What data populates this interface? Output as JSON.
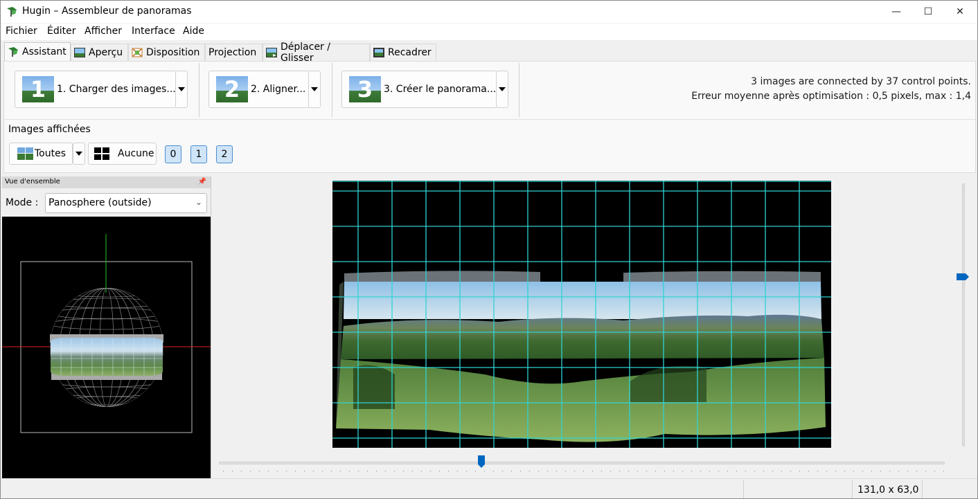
{
  "window": {
    "title": "Hugin – Assembleur de panoramas",
    "controls": {
      "minimize": "—",
      "maximize": "☐",
      "close": "✕"
    }
  },
  "menu": [
    "Fichier",
    "Éditer",
    "Afficher",
    "Interface",
    "Aide"
  ],
  "tabs": [
    {
      "label": "Assistant",
      "icon": "hugin-icon",
      "active": true
    },
    {
      "label": "Aperçu",
      "icon": "landscape-icon",
      "active": false
    },
    {
      "label": "Disposition",
      "icon": "layout-icon",
      "active": false
    },
    {
      "label": "Projection",
      "icon": "",
      "active": false
    },
    {
      "label": "Déplacer / Glisser",
      "icon": "move-icon",
      "active": false
    },
    {
      "label": "Recadrer",
      "icon": "crop-icon",
      "active": false
    }
  ],
  "steps": [
    {
      "number": "1",
      "label": "1. Charger des images..."
    },
    {
      "number": "2",
      "label": "2. Aligner..."
    },
    {
      "number": "3",
      "label": "3. Créer le panorama..."
    }
  ],
  "status": {
    "line1": "3 images are connected by 37 control points.",
    "line2": "Erreur moyenne après optimisation : 0,5 pixels, max : 1,4"
  },
  "shown_images": {
    "label": "Images affichées",
    "all_label": "Toutes",
    "none_label": "Aucune",
    "image_buttons": [
      "0",
      "1",
      "2"
    ]
  },
  "overview": {
    "title": "Vue d'ensemble",
    "mode_label": "Mode :",
    "mode_value": "Panosphere (outside)"
  },
  "statusbar": {
    "field_of_view": "131,0 x 63,0"
  },
  "sliders": {
    "horizontal_fraction": 0.36,
    "vertical_fraction": 0.35
  },
  "colors": {
    "grid": "#2fd3d3",
    "accent": "#0067c0",
    "axis_x": "#e02020",
    "axis_y": "#22c022"
  }
}
